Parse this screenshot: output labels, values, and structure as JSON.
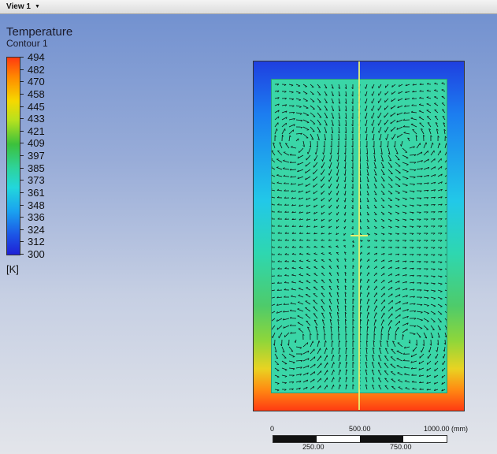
{
  "toolbar": {
    "view_label": "View 1"
  },
  "legend": {
    "title": "Temperature",
    "subtitle": "Contour 1",
    "values": [
      "494",
      "482",
      "470",
      "458",
      "445",
      "433",
      "421",
      "409",
      "397",
      "385",
      "373",
      "361",
      "348",
      "336",
      "324",
      "312",
      "300"
    ],
    "unit": "[K]"
  },
  "scale": {
    "top_labels": {
      "start": "0",
      "mid": "500.00",
      "end": "1000.00 (mm)"
    },
    "bottom_labels": {
      "q1": "250.00",
      "q3": "750.00"
    }
  },
  "colors": {
    "hot": "#ff3a10",
    "cold": "#1e20d6",
    "fluid": "#3ad6a7",
    "axis": "#e8f070"
  }
}
